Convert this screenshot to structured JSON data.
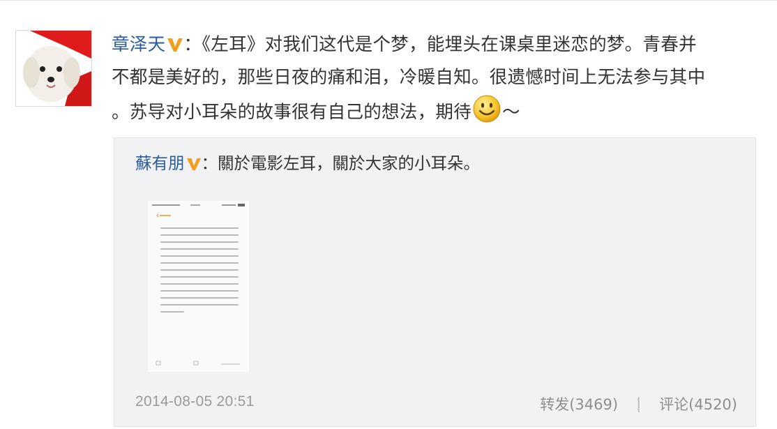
{
  "post": {
    "author": "章泽天",
    "separator": "：",
    "text_line1": "《左耳》对我们这代是个梦，能埋头在课桌里迷恋的梦。青春并",
    "text_line2": "不都是美好的，那些日夜的痛和泪，冷暖自知。很遗憾时间上无法参与其中",
    "text_line3": "。苏导对小耳朵的故事很有自己的想法，期待",
    "text_tail": "～"
  },
  "repost": {
    "author": "蘇有朋",
    "separator": "：",
    "text": "關於電影左耳，關於大家的小耳朵。",
    "date": "2014-08-05 20:51",
    "forward_label": "转发(3469)",
    "divider": "|",
    "comment_label": "评论(4520)"
  },
  "icons": {
    "verified": "verified-v-badge-icon",
    "emoji": "smiley-emoji-icon",
    "avatar": "white-puppy-avatar"
  },
  "colors": {
    "author_link": "#2a5d9a",
    "verified_badge": "#f0a020",
    "meta_text": "#9a9a9a"
  }
}
